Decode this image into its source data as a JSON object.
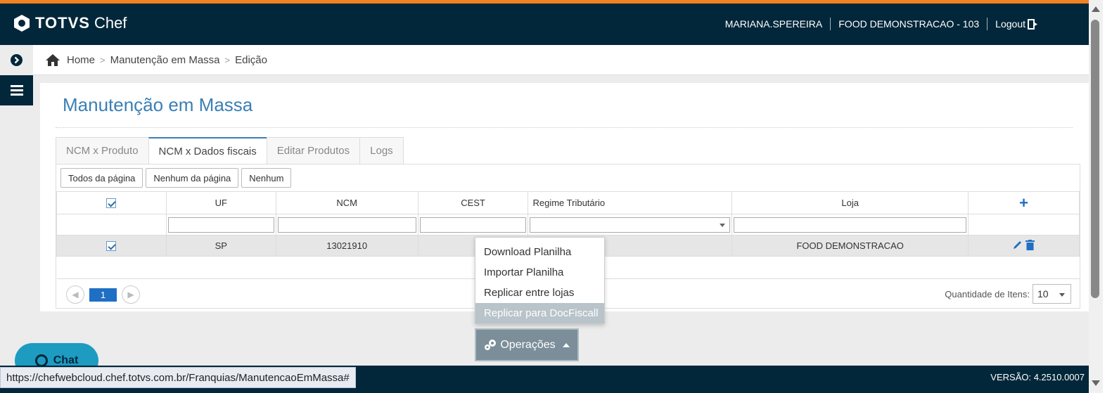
{
  "header": {
    "brand_main": "TOTVS",
    "brand_sub": "Chef",
    "username": "MARIANA.SPEREIRA",
    "store": "FOOD DEMONSTRACAO - 103",
    "logout_label": "Logout",
    "accent_color": "#f58220",
    "bg_color": "#02273a"
  },
  "breadcrumb": [
    "Home",
    "Manutenção em Massa",
    "Edição"
  ],
  "page": {
    "title": "Manutenção em Massa"
  },
  "tabs": [
    {
      "label": "NCM x Produto",
      "active": false
    },
    {
      "label": "NCM x Dados fiscais",
      "active": true
    },
    {
      "label": "Editar Produtos",
      "active": false
    },
    {
      "label": "Logs",
      "active": false
    }
  ],
  "selection_buttons": [
    "Todos da página",
    "Nenhum da página",
    "Nenhum"
  ],
  "table": {
    "columns": [
      "UF",
      "NCM",
      "CEST",
      "Regime Tributário",
      "Loja"
    ],
    "rows": [
      {
        "checked": true,
        "uf": "SP",
        "ncm": "13021910",
        "cest": "",
        "regime": "",
        "loja": "FOOD DEMONSTRACAO"
      }
    ]
  },
  "pager": {
    "current_page": "1",
    "qty_label": "Quantidade de Itens:",
    "qty_value": "10"
  },
  "operations_menu": {
    "button_label": "Operações",
    "items": [
      "Download Planilha",
      "Importar Planilha",
      "Replicar entre lojas",
      "Replicar para DocFiscall"
    ],
    "highlighted_index": 3
  },
  "chat": {
    "label": "Chat"
  },
  "footer": {
    "version": "VERSÃO: 4.2510.0007"
  },
  "status_url": "https://chefwebcloud.chef.totvs.com.br/Franquias/ManutencaoEmMassa#",
  "icons": [
    "totvs-logo-icon",
    "logout-icon",
    "chevron-right-circle-icon",
    "hamburger-icon",
    "home-icon",
    "plus-icon",
    "pencil-icon",
    "trash-icon",
    "gears-icon",
    "chat-icon"
  ]
}
